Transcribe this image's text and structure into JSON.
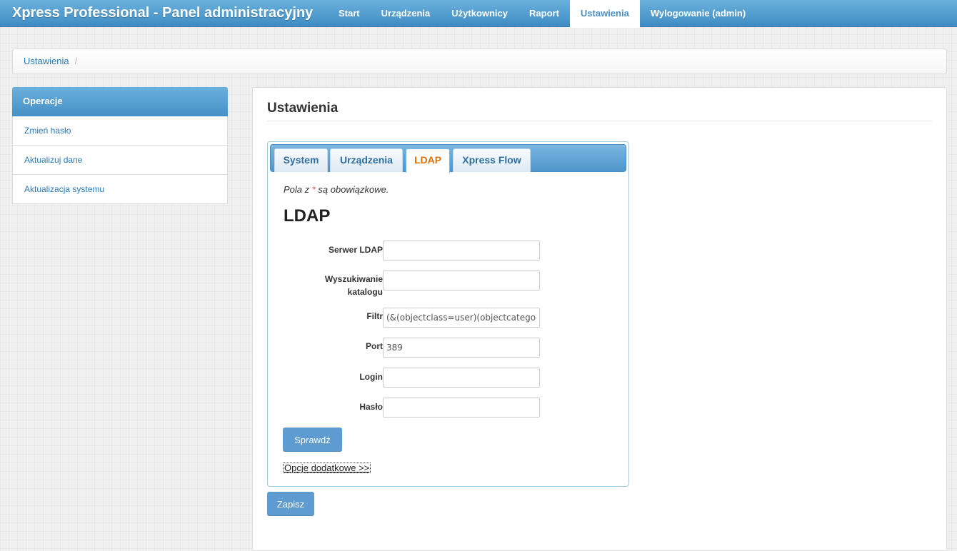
{
  "app": {
    "title": "Xpress Professional - Panel administracyjny"
  },
  "nav": {
    "items": [
      {
        "label": "Start"
      },
      {
        "label": "Urządzenia"
      },
      {
        "label": "Użytkownicy"
      },
      {
        "label": "Raport"
      },
      {
        "label": "Ustawienia",
        "active": true
      },
      {
        "label": "Wylogowanie (admin)"
      }
    ]
  },
  "breadcrumb": {
    "items": [
      "Ustawienia"
    ],
    "separator": "/"
  },
  "sidebar": {
    "header": "Operacje",
    "items": [
      {
        "label": "Zmień hasło"
      },
      {
        "label": "Aktualizuj dane"
      },
      {
        "label": "Aktualizacja systemu"
      }
    ]
  },
  "main": {
    "title": "Ustawienia",
    "tabs": [
      {
        "label": "System"
      },
      {
        "label": "Urządzenia"
      },
      {
        "label": "LDAP",
        "active": true
      },
      {
        "label": "Xpress Flow"
      }
    ],
    "required_note": {
      "before": "Pola z ",
      "star": "*",
      "after": " są obowiązkowe."
    },
    "section_title": "LDAP",
    "fields": {
      "server": {
        "label": "Serwer LDAP",
        "value": ""
      },
      "search": {
        "label_line1": "Wyszukiwanie",
        "label_line2": "katalogu",
        "value": ""
      },
      "filter": {
        "label": "Filtr",
        "value": "(&(objectclass=user)(objectcategory=person))"
      },
      "port": {
        "label": "Port",
        "value": "389"
      },
      "login": {
        "label": "Login",
        "value": ""
      },
      "password": {
        "label": "Hasło",
        "value": ""
      }
    },
    "check_button": "Sprawdź",
    "more_options": "Opcje dodatkowe >>",
    "save_button": "Zapisz"
  },
  "colors": {
    "accent": "#4a90c8",
    "link": "#2a7ab8",
    "active_tab": "#e17009",
    "button": "#5e9bd0",
    "required_star": "#d9534f"
  }
}
